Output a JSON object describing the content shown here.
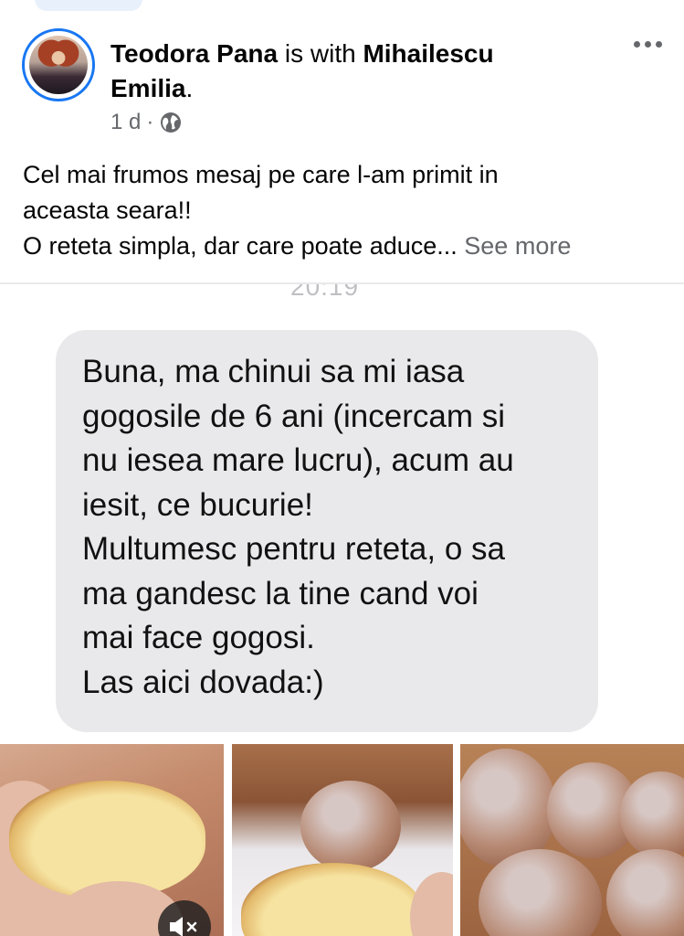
{
  "post": {
    "author": "Teodora Pana",
    "with_word": " is with ",
    "tagged": "Mihailescu",
    "tagged_line2": "Emilia",
    "period": ".",
    "time": "1 d",
    "dot": "·",
    "privacy_icon": "globe-icon",
    "more_icon": "more-options-icon",
    "text_lines": [
      "Cel mai frumos mesaj pe care l-am primit in",
      "aceasta seara!!",
      "O reteta simpla, dar care poate aduce..."
    ],
    "see_more": "See more"
  },
  "message_screenshot": {
    "timestamp": "20:19",
    "bubble_lines": [
      "Buna, ma chinui sa mi iasa",
      "gogosile de 6 ani (incercam si",
      "nu iesea mare lucru), acum au",
      "iesit, ce bucurie!",
      "Multumesc pentru reteta, o sa",
      "ma gandesc la tine cand voi",
      "mai face gogosi.",
      "Las aici dovada:)"
    ]
  },
  "photos": {
    "mute_icon": "muted-speaker-icon"
  },
  "colors": {
    "accent": "#1877f2",
    "secondary_text": "#65676b",
    "bubble": "#e9e9eb"
  }
}
